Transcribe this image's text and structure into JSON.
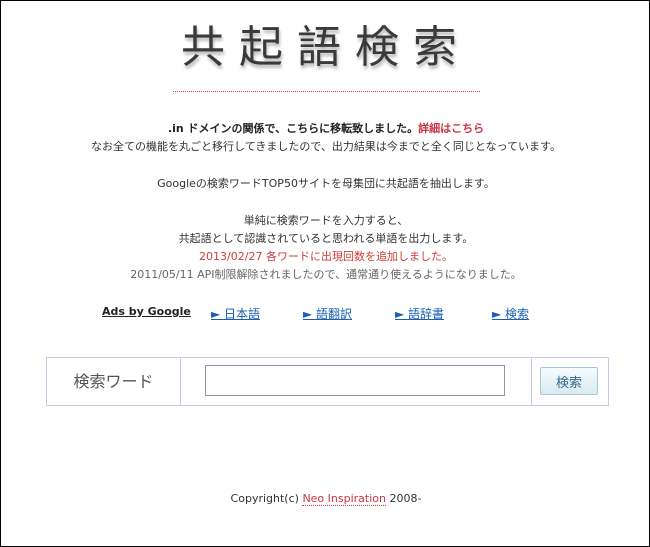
{
  "logo": {
    "text": "共起語検索"
  },
  "notice": {
    "line1_domain": ".in",
    "line1_text": " ドメインの関係で、こちらに移転致しました。",
    "line1_link": "詳細はこちら",
    "line2": "なお全ての機能を丸ごと移行してきましたので、出力結果は今までと全く同じとなっています。"
  },
  "description": {
    "line1": "Googleの検索ワードTOP50サイトを母集団に共起語を抽出します。",
    "line2": "単純に検索ワードを入力すると、",
    "line3": "共起語として認識されていると思われる単語を出力します。",
    "update1": "2013/02/27 各ワードに出現回数を追加しました。",
    "update2": "2011/05/11 API制限解除されましたので、通常通り使えるようになりました。"
  },
  "ads": {
    "label": "Ads by Google",
    "links": [
      "► 日本語",
      "► 語翻訳",
      "► 語辞書",
      "► 検索"
    ]
  },
  "search": {
    "label": "検索ワード",
    "input_value": "",
    "input_placeholder": "",
    "button_label": "検索"
  },
  "footer": {
    "prefix": "Copyright(c) ",
    "link": "Neo Inspiration",
    "suffix": " 2008-"
  },
  "colors": {
    "accent_red": "#d03a3a",
    "link_blue": "#1a5fb4",
    "box_border": "#c9c9e8"
  }
}
